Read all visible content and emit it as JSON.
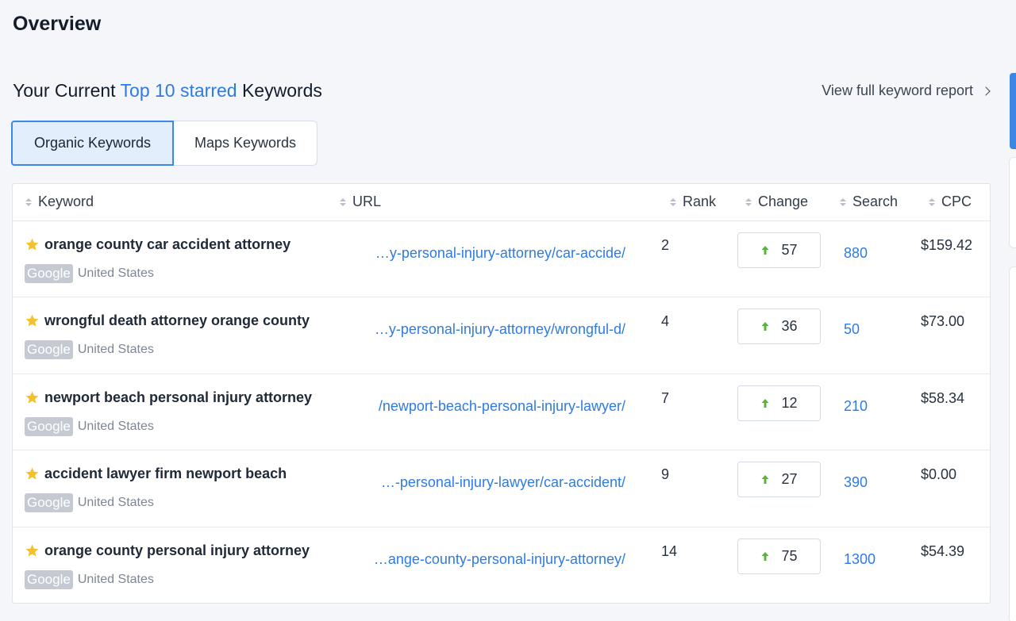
{
  "page": {
    "title": "Overview"
  },
  "section": {
    "title_prefix": "Your Current ",
    "title_accent": "Top 10 starred",
    "title_suffix": " Keywords",
    "full_report_link": "View full keyword report"
  },
  "tabs": [
    {
      "label": "Organic Keywords",
      "active": true
    },
    {
      "label": "Maps Keywords",
      "active": false
    }
  ],
  "table": {
    "columns": [
      "Keyword",
      "URL",
      "Rank",
      "Change",
      "Search",
      "CPC"
    ],
    "rows": [
      {
        "keyword": "orange county car accident attorney",
        "engine": "Google",
        "country": "United States",
        "url": "…y-personal-injury-attorney/car-accide/",
        "rank": "2",
        "change": "57",
        "search": "880",
        "cpc": "$159.42"
      },
      {
        "keyword": "wrongful death attorney orange county",
        "engine": "Google",
        "country": "United States",
        "url": "…y-personal-injury-attorney/wrongful-d/",
        "rank": "4",
        "change": "36",
        "search": "50",
        "cpc": "$73.00"
      },
      {
        "keyword": "newport beach personal injury attorney",
        "engine": "Google",
        "country": "United States",
        "url": "/newport-beach-personal-injury-lawyer/",
        "rank": "7",
        "change": "12",
        "search": "210",
        "cpc": "$58.34"
      },
      {
        "keyword": "accident lawyer firm newport beach",
        "engine": "Google",
        "country": "United States",
        "url": "…-personal-injury-lawyer/car-accident/",
        "rank": "9",
        "change": "27",
        "search": "390",
        "cpc": "$0.00"
      },
      {
        "keyword": "orange county personal injury attorney",
        "engine": "Google",
        "country": "United States",
        "url": "…ange-county-personal-injury-attorney/",
        "rank": "14",
        "change": "75",
        "search": "1300",
        "cpc": "$54.39"
      }
    ]
  },
  "icons": {
    "star": "star-icon",
    "change_arrow": "arrow-up-icon",
    "sort": "sort-icon",
    "link_chevron": "chevron-right-icon"
  },
  "colors": {
    "accent": "#2f7be0",
    "star": "#f5c02c",
    "change_up": "#5bb33c",
    "badge_bg": "#c5cad2",
    "background": "#f4f6fa"
  }
}
